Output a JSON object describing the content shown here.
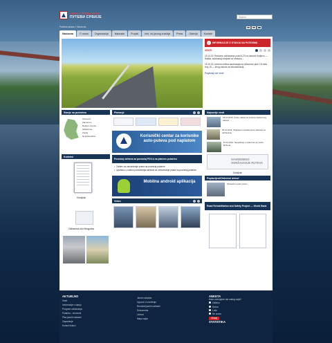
{
  "header": {
    "brand_line1": "ЈАВНО ПРЕДУЗЕЋЕ",
    "brand_line2": "ПУТЕВИ СРБИЈЕ",
    "search_placeholder": "Search",
    "breadcrumb": "Početna strana > Naslovna"
  },
  "nav": {
    "tabs": [
      "Naslovna",
      "O nama",
      "Organizacija",
      "Naknade",
      "Propisi",
      "Info. od javnog značaja",
      "Press",
      "Galerija",
      "Kontakt"
    ]
  },
  "news": {
    "alert": "INFORMACIJE O STANJU NA PUTEVIMA",
    "heading": "VESTI",
    "items": [
      "15.10.15. Redovno održavanje puta M-22 na deonici Kraljevo — Raška, saobraćaj odvijaće se otežano...",
      "15.10.15. Izmena režima saobraćaja na državnom putu I B reda broj 15 — zbog radova na rekonstrukciji..."
    ],
    "link": "Pogledaj sve vesti"
  },
  "left": {
    "road_state_head": "Stanje na putevima",
    "road_state_legend": [
      "Otvoreno",
      "Zatvoreno",
      "Radovi na putu",
      "Obilaznica",
      "Zastoj",
      "Nepristupačno"
    ],
    "kodeks_head": "Kodeksi",
    "kodeks_caption": "Detaljnije",
    "map_caption": "Obilaznica oko Beograda"
  },
  "middle": {
    "banks_head": "Plaćanje",
    "toll_banner": "Korisnički centar za korisnike auto-puteva pod naplatom",
    "pdv_head": "Povraćaj zahteva za povraćaj PDV-a na plaćenu putarinu",
    "pdv_items": [
      "Zahtev za ostvarivanje prava na povraćaj putarine",
      "Uputstvo o načinu podnošenja zahteva za ostvarivanje prava na povraćaj putarine"
    ],
    "android_banner": "Mobilna android aplikacija",
    "video_head": "Video"
  },
  "right": {
    "news_head": "Najnovije vesti",
    "items": [
      "26.10.2015. Iznete odluke sa sednice Nadzornog odbora",
      "25.10.2015. Objavljeni rezultati javne nabavke za održavanje",
      "23.10.2015. Saopštenje o radovima na mostu Sloboda"
    ],
    "sav_banner": "SAVREMENO ODRŽAVANJE PUTEVA",
    "sav_caption": "Detaljnije",
    "flood_head": "Poplavljeni/Oštećeni delovi",
    "flood_text": "Obeleženi putni pravci",
    "rehab_head": "Road Rehabilitation and Safety Project — World Bank"
  },
  "footer": {
    "col1_head": "AKTUELNO",
    "col1_items": [
      "Vesti",
      "Informacije o stanju",
      "Program održavanja",
      "Putarina - cenovnik",
      "Plan javnih nabavki",
      "Zaposlenje",
      "Korisni linkovi"
    ],
    "col2_items": [
      "Javne nabavke",
      "Ugovori o izvođenju",
      "Rezultati javnih nabavki",
      "Dokumenta",
      "Linkovi",
      "Mapa sajta"
    ],
    "poll_head": "ANKETA",
    "poll_question": "Kako ocenjujete rad našeg sajta?",
    "poll_options": [
      "Odlično",
      "Dobro",
      "Loše",
      "Ne znam"
    ],
    "vote_label": "Glasaj",
    "stats_head": "STATISTIKA"
  },
  "colors": {
    "accent_red": "#c9252a",
    "nav_dark": "#173356"
  }
}
